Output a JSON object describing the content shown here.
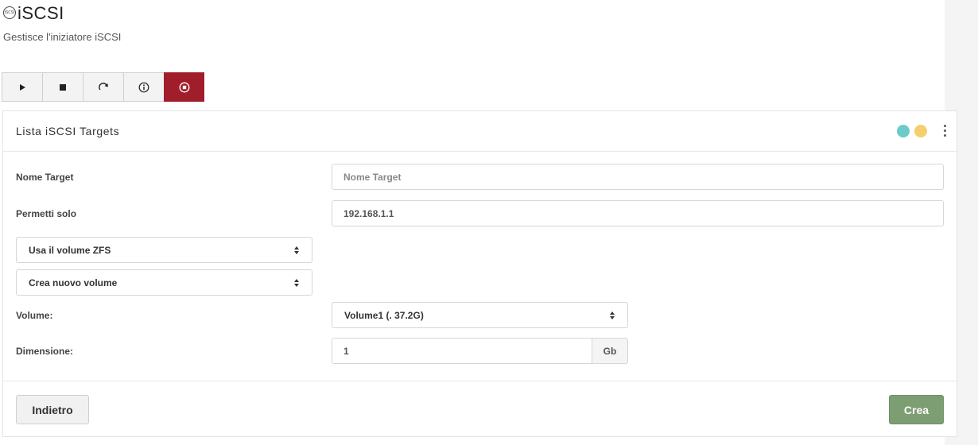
{
  "header": {
    "icon": "iscsi-logo-icon",
    "icon_text": "iSCSI",
    "title": "iSCSI",
    "subtitle": "Gestisce l'iniziatore iSCSI"
  },
  "toolbar": {
    "buttons": [
      {
        "name": "play-icon",
        "active": false
      },
      {
        "name": "stop-square-icon",
        "active": false
      },
      {
        "name": "restart-icon",
        "active": false
      },
      {
        "name": "info-icon",
        "active": false
      },
      {
        "name": "stop-circle-icon",
        "active": true
      }
    ],
    "active_color": "#a01d2a"
  },
  "panel": {
    "title": "Lista iSCSI Targets",
    "status_dots": [
      "#6ccaca",
      "#f5cf6d"
    ],
    "menu_icon": "kebab-menu-icon"
  },
  "form": {
    "target_name_label": "Nome Target",
    "target_name_value": "",
    "target_name_placeholder": "Nome Target",
    "allow_only_label": "Permetti solo",
    "allow_only_value": "192.168.1.1",
    "volume_type_select": "Usa il volume ZFS",
    "volume_mode_select": "Crea nuovo volume",
    "volume_label": "Volume:",
    "volume_select": "Volume1 (. 37.2G)",
    "size_label": "Dimensione:",
    "size_value": "1",
    "size_unit": "Gb"
  },
  "actions": {
    "back_label": "Indietro",
    "create_label": "Crea",
    "create_color": "#7d9d73"
  }
}
